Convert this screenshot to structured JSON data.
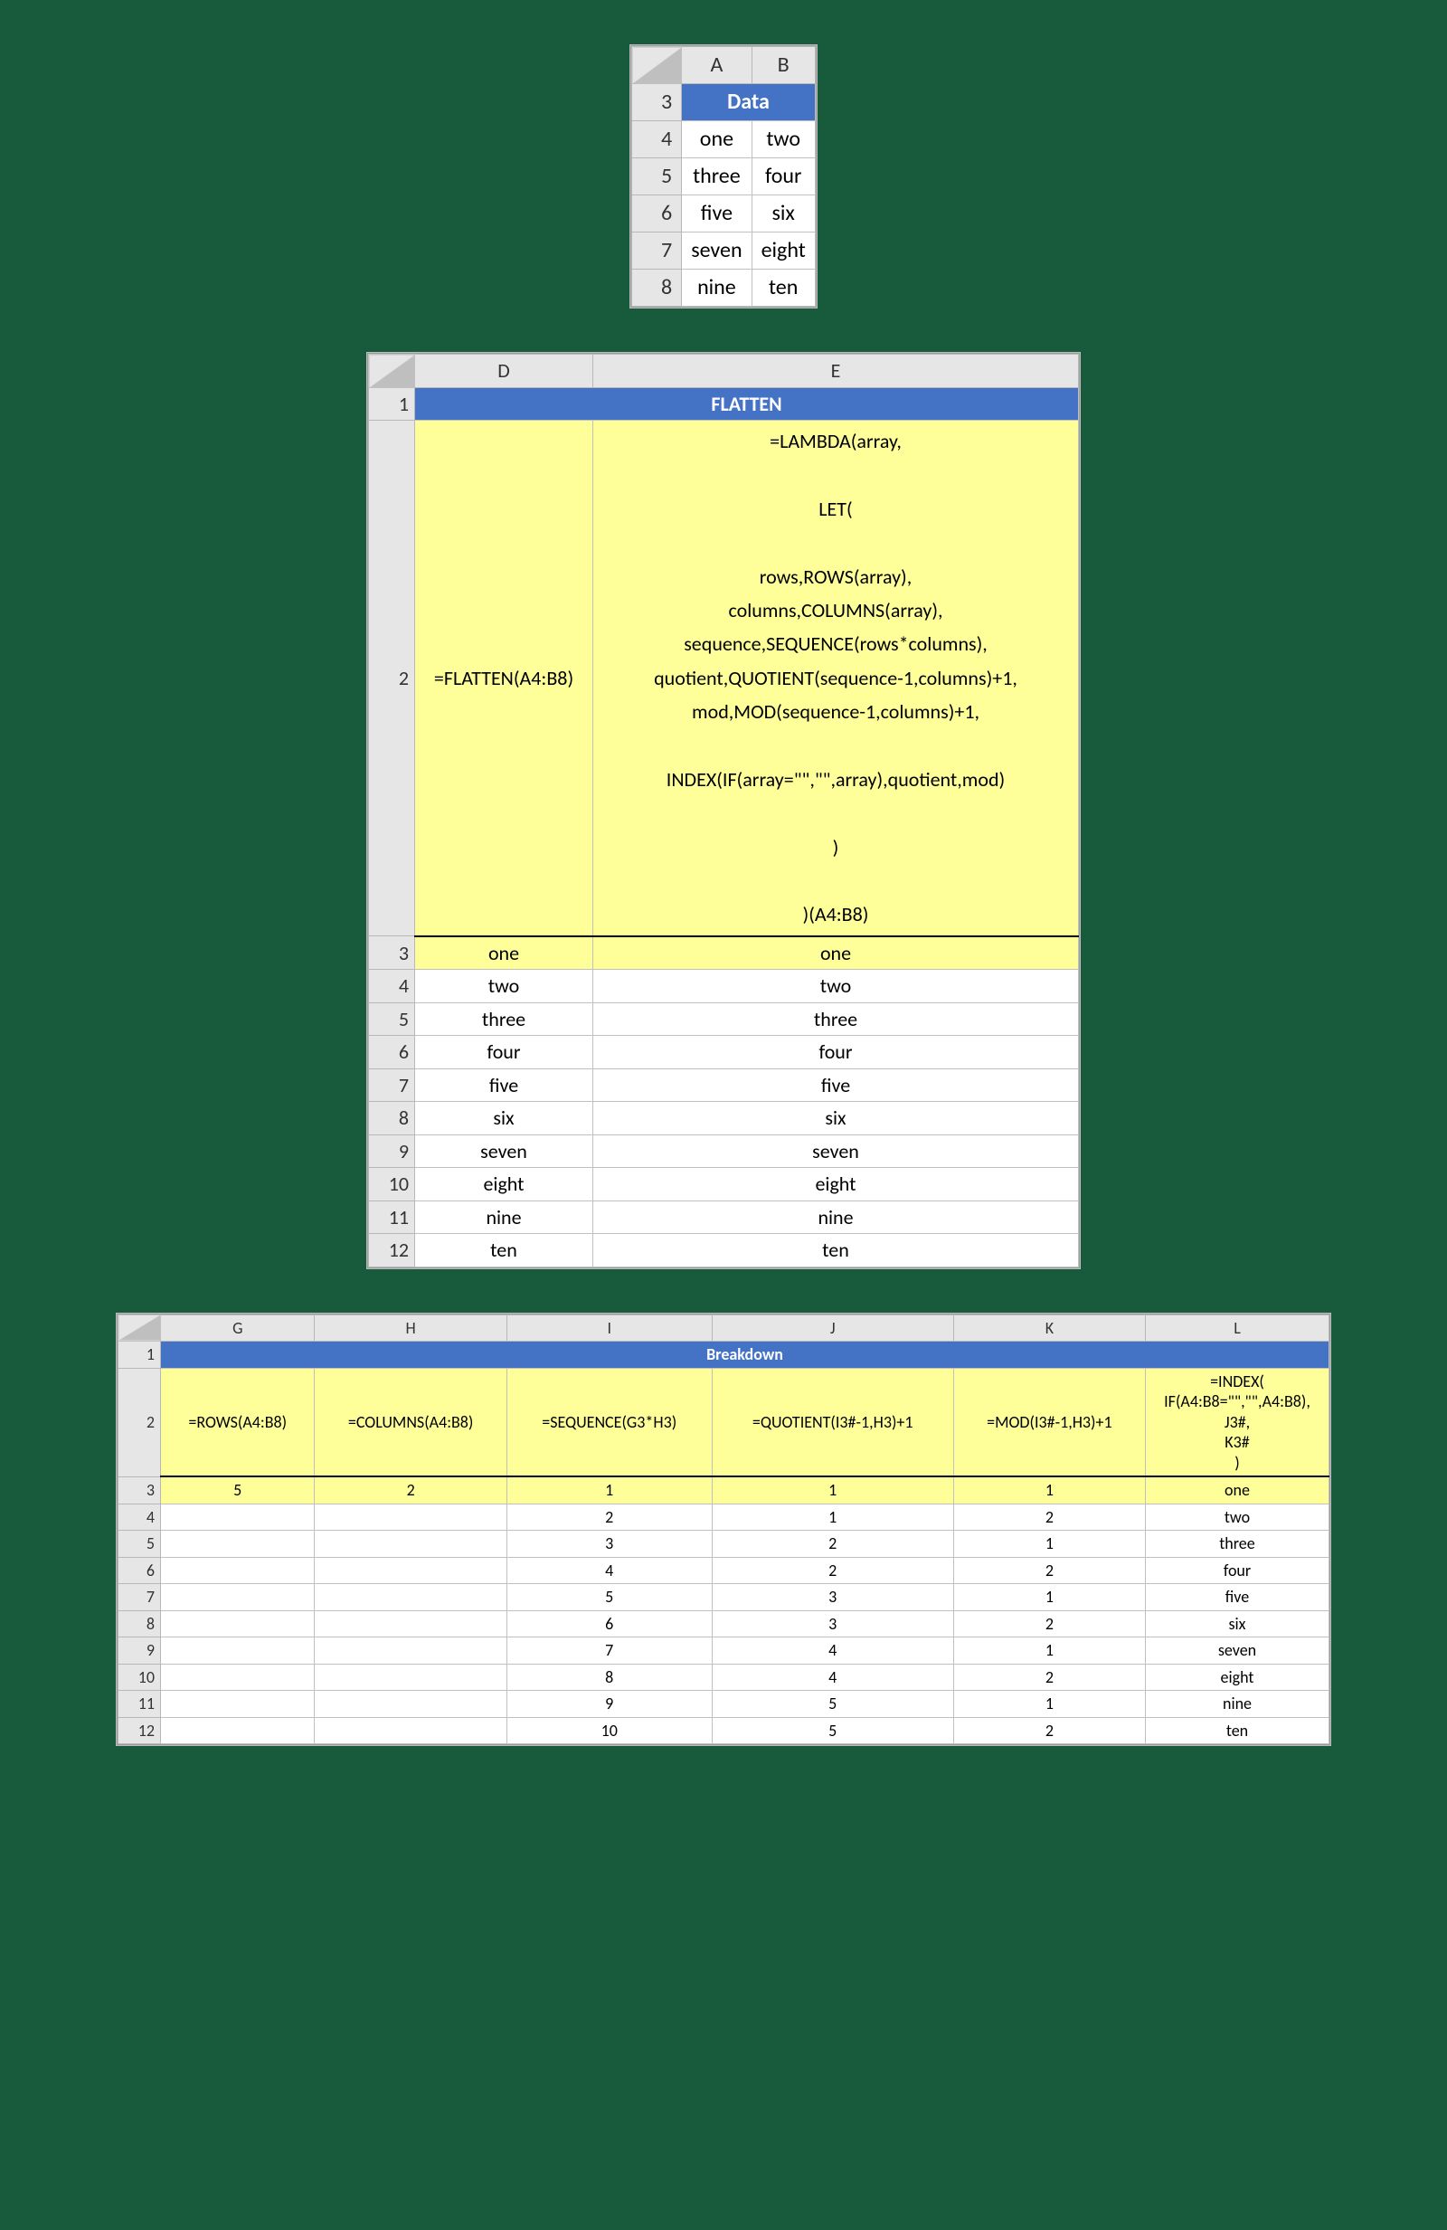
{
  "table1": {
    "cols": [
      "A",
      "B"
    ],
    "header": "Data",
    "rowStart": 3,
    "rows": [
      [
        "one",
        "two"
      ],
      [
        "three",
        "four"
      ],
      [
        "five",
        "six"
      ],
      [
        "seven",
        "eight"
      ],
      [
        "nine",
        "ten"
      ]
    ]
  },
  "table2": {
    "cols": [
      "D",
      "E"
    ],
    "header": "FLATTEN",
    "formulaRow": {
      "rownum": "2",
      "d": "=FLATTEN(A4:B8)",
      "e": "=LAMBDA(array,\n\nLET(\n\nrows,ROWS(array),\ncolumns,COLUMNS(array),\nsequence,SEQUENCE(rows*columns),\nquotient,QUOTIENT(sequence-1,columns)+1,\nmod,MOD(sequence-1,columns)+1,\n\nINDEX(IF(array=\"\",\"\",array),quotient,mod)\n\n)\n\n)(A4:B8)"
    },
    "rows": [
      {
        "n": "3",
        "d": "one",
        "e": "one",
        "yellow": true
      },
      {
        "n": "4",
        "d": "two",
        "e": "two"
      },
      {
        "n": "5",
        "d": "three",
        "e": "three"
      },
      {
        "n": "6",
        "d": "four",
        "e": "four"
      },
      {
        "n": "7",
        "d": "five",
        "e": "five"
      },
      {
        "n": "8",
        "d": "six",
        "e": "six"
      },
      {
        "n": "9",
        "d": "seven",
        "e": "seven"
      },
      {
        "n": "10",
        "d": "eight",
        "e": "eight"
      },
      {
        "n": "11",
        "d": "nine",
        "e": "nine"
      },
      {
        "n": "12",
        "d": "ten",
        "e": "ten"
      }
    ]
  },
  "table3": {
    "cols": [
      "G",
      "H",
      "I",
      "J",
      "K",
      "L"
    ],
    "header": "Breakdown",
    "formulaRow": {
      "n": "2",
      "g": "=ROWS(A4:B8)",
      "h": "=COLUMNS(A4:B8)",
      "i": "=SEQUENCE(G3*H3)",
      "j": "=QUOTIENT(I3#-1,H3)+1",
      "k": "=MOD(I3#-1,H3)+1",
      "l": "=INDEX(\nIF(A4:B8=\"\",\"\",A4:B8),\nJ3#,\nK3#\n)"
    },
    "rows": [
      {
        "n": "3",
        "g": "5",
        "h": "2",
        "i": "1",
        "j": "1",
        "k": "1",
        "l": "one",
        "yellow": true
      },
      {
        "n": "4",
        "g": "",
        "h": "",
        "i": "2",
        "j": "1",
        "k": "2",
        "l": "two"
      },
      {
        "n": "5",
        "g": "",
        "h": "",
        "i": "3",
        "j": "2",
        "k": "1",
        "l": "three"
      },
      {
        "n": "6",
        "g": "",
        "h": "",
        "i": "4",
        "j": "2",
        "k": "2",
        "l": "four"
      },
      {
        "n": "7",
        "g": "",
        "h": "",
        "i": "5",
        "j": "3",
        "k": "1",
        "l": "five"
      },
      {
        "n": "8",
        "g": "",
        "h": "",
        "i": "6",
        "j": "3",
        "k": "2",
        "l": "six"
      },
      {
        "n": "9",
        "g": "",
        "h": "",
        "i": "7",
        "j": "4",
        "k": "1",
        "l": "seven"
      },
      {
        "n": "10",
        "g": "",
        "h": "",
        "i": "8",
        "j": "4",
        "k": "2",
        "l": "eight"
      },
      {
        "n": "11",
        "g": "",
        "h": "",
        "i": "9",
        "j": "5",
        "k": "1",
        "l": "nine"
      },
      {
        "n": "12",
        "g": "",
        "h": "",
        "i": "10",
        "j": "5",
        "k": "2",
        "l": "ten"
      }
    ]
  }
}
